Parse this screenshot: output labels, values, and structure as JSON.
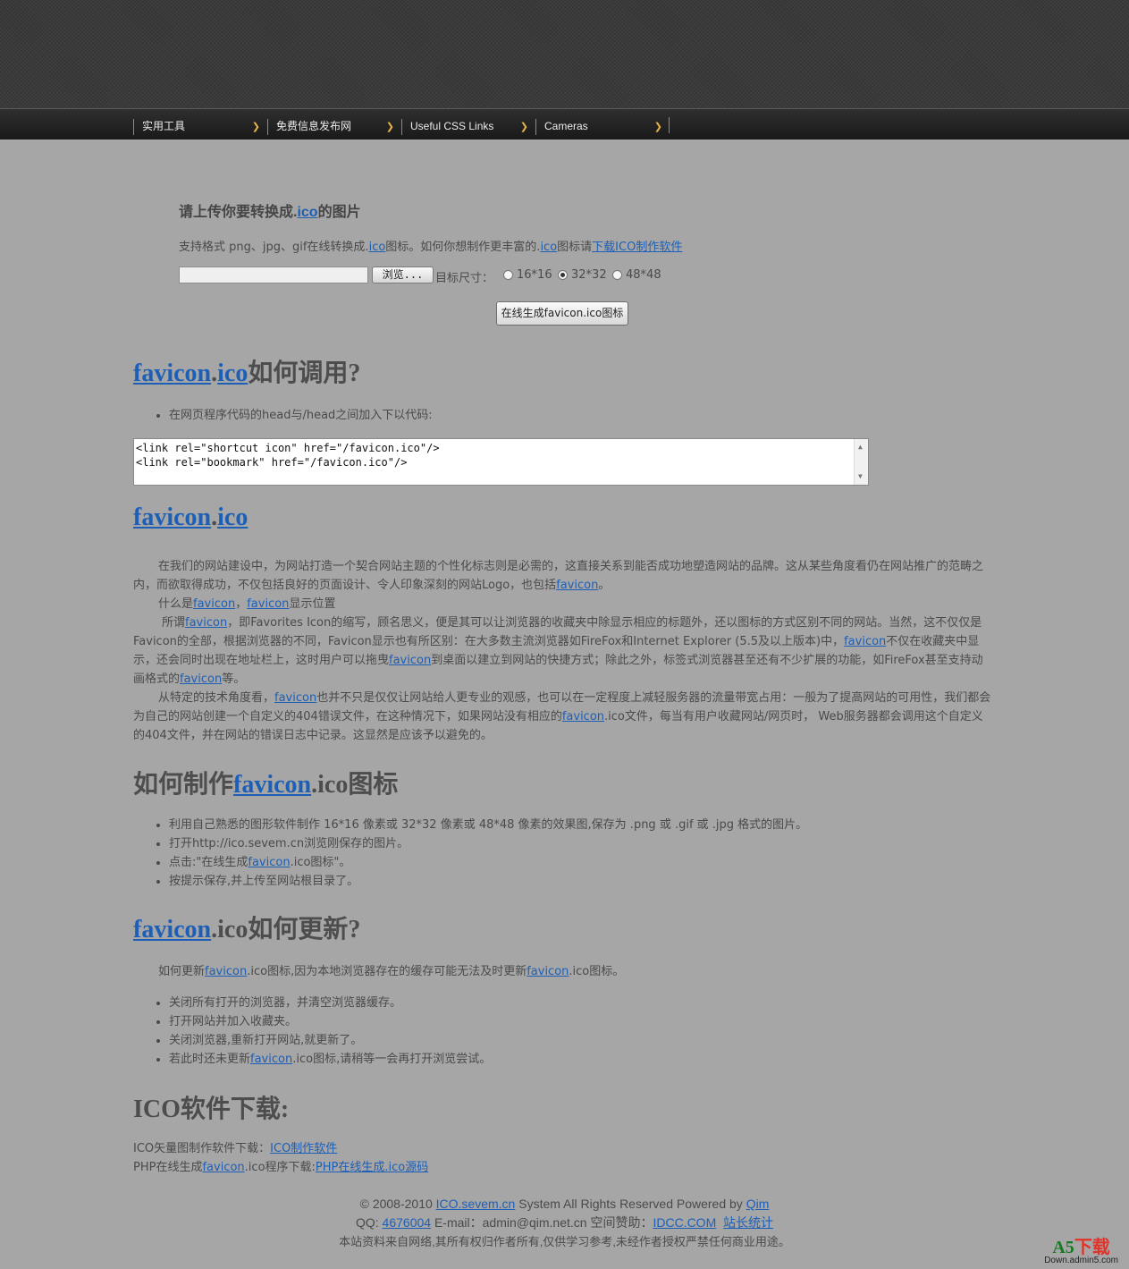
{
  "nav": {
    "items": [
      {
        "label": "实用工具"
      },
      {
        "label": "免费信息发布网"
      },
      {
        "label": "Useful CSS Links"
      },
      {
        "label": "Cameras"
      }
    ]
  },
  "upload": {
    "title_pre": "请上传你要转换成.",
    "title_link": "ico",
    "title_post": "的图片",
    "desc_pre": "支持格式 png、jpg、gif在线转换成.",
    "desc_link1": "ico",
    "desc_mid": "图标。如何你想制作更丰富的.",
    "desc_link2": "ico",
    "desc_mid2": "图标请",
    "desc_link3": "下载ICO制作软件",
    "browse_label": "浏览...",
    "size_label": "目标尺寸：",
    "sizes": [
      {
        "label": "16*16",
        "checked": false
      },
      {
        "label": "32*32",
        "checked": true
      },
      {
        "label": "48*48",
        "checked": false
      }
    ],
    "generate_label": "在线生成favicon.ico图标"
  },
  "howto_use": {
    "title_link1": "favicon",
    "title_dot": ".",
    "title_link2": "ico",
    "title_post": "如何调用?",
    "bullet": "在网页程序代码的head与/head之间加入下以代码:",
    "code": "<link rel=\"shortcut icon\" href=\"/favicon.ico\"/>\n<link rel=\"bookmark\" href=\"/favicon.ico\"/>"
  },
  "about": {
    "title_link1": "favicon",
    "title_dot": ".",
    "title_link2": "ico",
    "p1_pre": "在我们的网站建设中，为网站打造一个契合网站主题的个性化标志则是必需的，这直接关系到能否成功地塑造网站的品牌。这从某些角度看仍在网站推广的范畴之内，而欲取得成功，不仅包括良好的页面设计、令人印象深刻的网站Logo，也包括",
    "p1_link": "favicon",
    "p1_post": "。",
    "p2_pre": "什么是",
    "p2_link1": "favicon",
    "p2_mid": "，",
    "p2_link2": "favicon",
    "p2_post": "显示位置",
    "p3_pre": "所谓",
    "p3_link1": "favicon",
    "p3_a": "，即Favorites Icon的缩写，顾名思义，便是其可以让浏览器的收藏夹中除显示相应的标题外，还以图标的方式区别不同的网站。当然，这不仅仅是Favicon的全部，根据浏览器的不同，Favicon显示也有所区别：在大多数主流浏览器如FireFox和Internet Explorer (5.5及以上版本)中，",
    "p3_link2": "favicon",
    "p3_b": "不仅在收藏夹中显示，还会同时出现在地址栏上，这时用户可以拖曳",
    "p3_link3": "favicon",
    "p3_c": "到桌面以建立到网站的快捷方式；除此之外，标签式浏览器甚至还有不少扩展的功能，如FireFox甚至支持动画格式的",
    "p3_link4": "favicon",
    "p3_d": "等。",
    "p4_pre": "从特定的技术角度看，",
    "p4_link1": "favicon",
    "p4_a": "也并不只是仅仅让网站给人更专业的观感，也可以在一定程度上减轻服务器的流量带宽占用：一般为了提高网站的可用性，我们都会为自己的网站创建一个自定义的404错误文件，在这种情况下，如果网站没有相应的",
    "p4_link2": "favicon",
    "p4_b": ".ico文件，每当有用户收藏网站/网页时， Web服务器都会调用这个自定义的404文件，并在网站的错误日志中记录。这显然是应该予以避免的。"
  },
  "make": {
    "title_pre": "如何制作",
    "title_link": "favicon",
    "title_post": ".ico图标",
    "b1": "利用自己熟悉的图形软件制作 16*16 像素或 32*32 像素或 48*48 像素的效果图,保存为 .png 或 .gif 或 .jpg 格式的图片。",
    "b2": "打开http://ico.sevem.cn浏览刚保存的图片。",
    "b3_pre": "点击:\"在线生成",
    "b3_link": "favicon",
    "b3_post": ".ico图标\"。",
    "b4": "按提示保存,并上传至网站根目录了。"
  },
  "update": {
    "title_link": "favicon",
    "title_post": ".ico如何更新?",
    "intro_pre": "如何更新",
    "intro_link1": "favicon",
    "intro_mid": ".ico图标,因为本地浏览器存在的缓存可能无法及时更新",
    "intro_link2": "favicon",
    "intro_post": ".ico图标。",
    "b1": "关闭所有打开的浏览器，并清空浏览器缓存。",
    "b2": "打开网站并加入收藏夹。",
    "b3": "关闭浏览器,重新打开网站,就更新了。",
    "b4_pre": "若此时还未更新",
    "b4_link": "favicon",
    "b4_post": ".ico图标,请稍等一会再打开浏览尝试。"
  },
  "download": {
    "title": "ICO软件下载:",
    "l1_pre": "ICO矢量图制作软件下载：",
    "l1_link": "ICO制作软件",
    "l2_pre": "PHP在线生成",
    "l2_link1": "favicon",
    "l2_mid": ".ico程序下载:",
    "l2_link2": "PHP在线生成.ico源码"
  },
  "footer": {
    "copy_pre": "© 2008-2010 ",
    "copy_link1": "ICO.sevem.cn",
    "copy_mid": " System All Rights Reserved Powered by ",
    "copy_link2": "Qim",
    "qq_pre": "QQ: ",
    "qq_link": "4676004",
    "qq_mid": " E-mail：admin@qim.net.cn 空间赞助：",
    "qq_link2": "IDCC.COM",
    "qq_sp": "  ",
    "qq_link3": "站长统计",
    "note": "本站资料来自网络,其所有权归作者所有,仅供学习参考,未经作者授权严禁任何商业用途。"
  },
  "watermark": {
    "brand_a": "A5",
    "brand_b": "下载",
    "site": "Down.admin5.com"
  }
}
